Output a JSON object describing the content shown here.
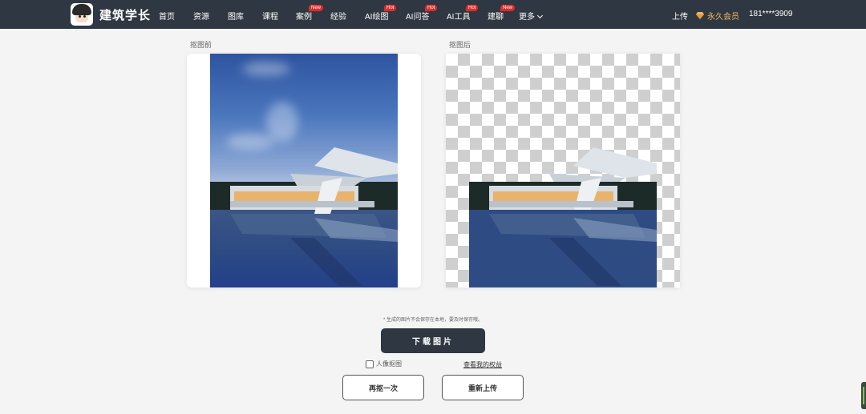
{
  "header": {
    "logo_text": "建筑学长",
    "nav": [
      {
        "label": "首页",
        "badge": ""
      },
      {
        "label": "资源",
        "badge": ""
      },
      {
        "label": "图库",
        "badge": ""
      },
      {
        "label": "课程",
        "badge": ""
      },
      {
        "label": "案例",
        "badge": "New"
      },
      {
        "label": "经验",
        "badge": ""
      },
      {
        "label": "AI绘图",
        "badge": "Hot"
      },
      {
        "label": "AI问答",
        "badge": "Hot"
      },
      {
        "label": "AI工具",
        "badge": "Hot"
      },
      {
        "label": "建聊",
        "badge": "New"
      },
      {
        "label": "更多",
        "badge": ""
      }
    ],
    "upload_label": "上传",
    "vip_label": "永久会员",
    "phone": "181****3909",
    "badge_color": "#e02b2b",
    "vip_color": "#f1b461",
    "bar_color": "#2f3842"
  },
  "panels": {
    "before_label": "抠图前",
    "after_label": "抠图后"
  },
  "actions": {
    "notice": "* 生成的图片不会保存在本地，要及时保存哦。",
    "download_label": "下载图片",
    "portrait_label": "人像抠图",
    "rights_label": "查看我的权益",
    "retry_label": "再抠一次",
    "reupload_label": "重新上传"
  }
}
